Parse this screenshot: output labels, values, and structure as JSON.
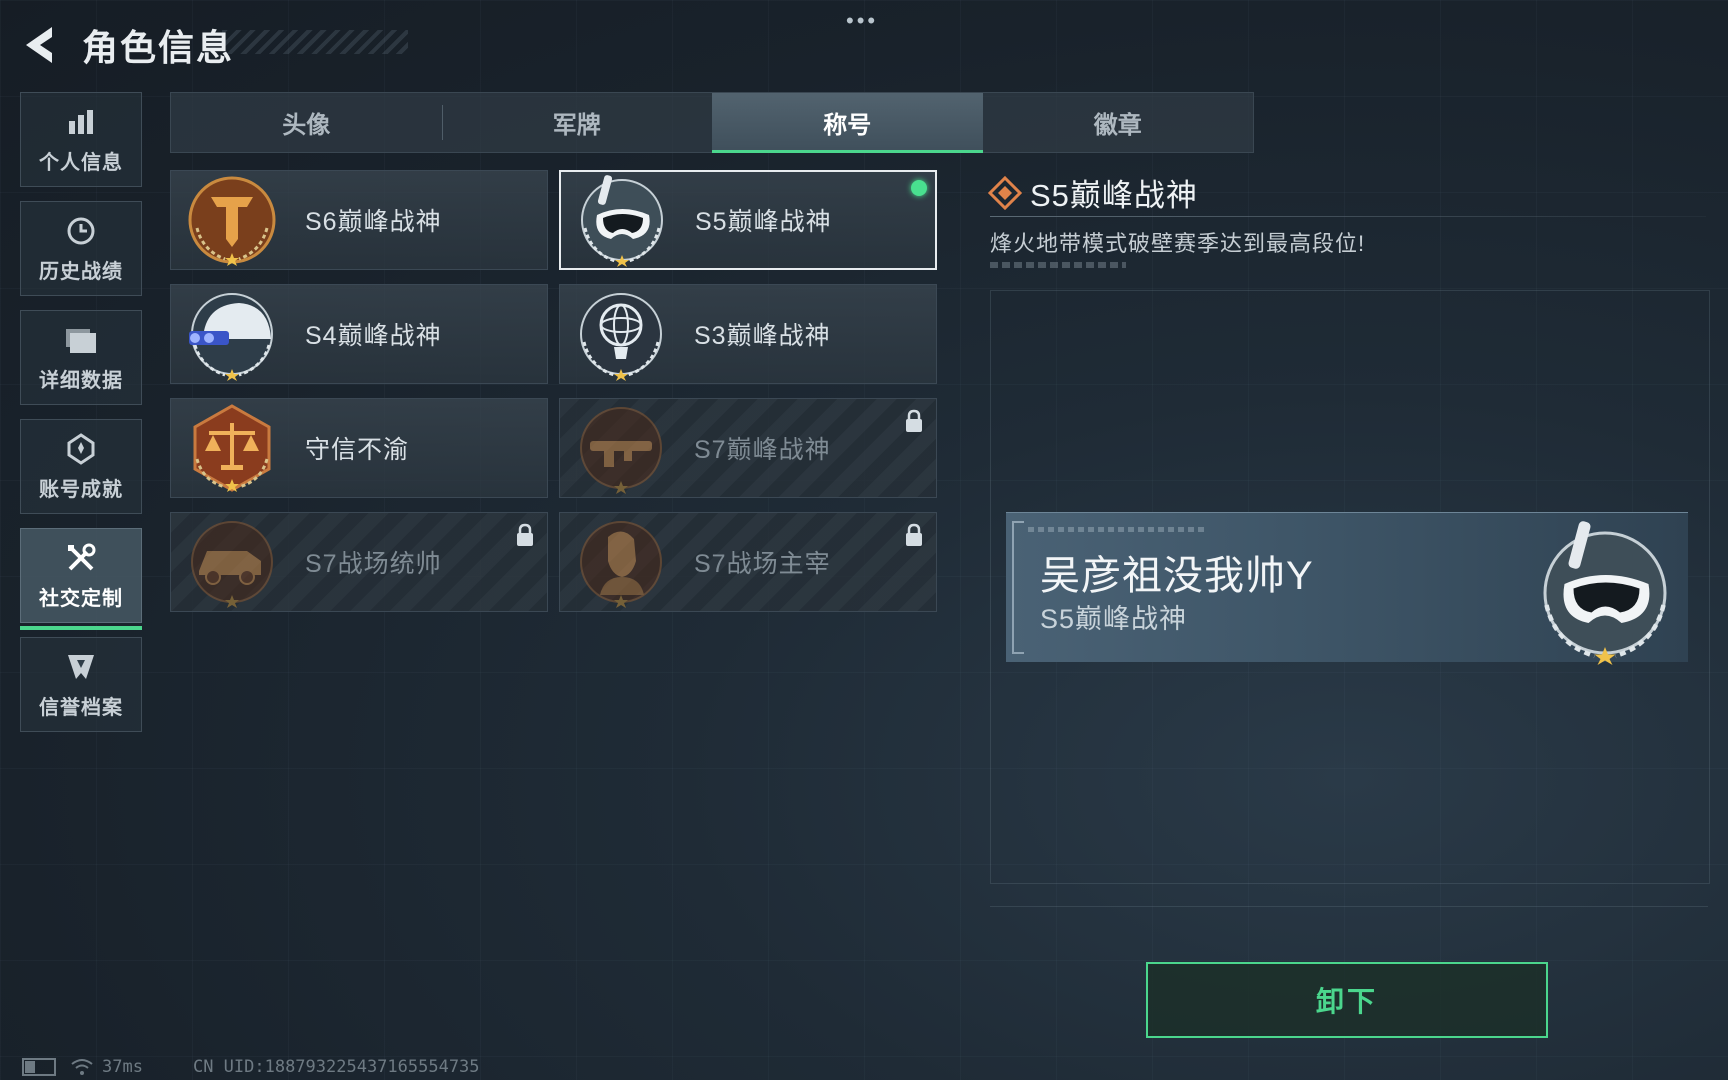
{
  "header": {
    "title": "角色信息",
    "menu_dots": "•••"
  },
  "sidebar": {
    "items": [
      {
        "label": "个人信息",
        "icon": "bar-chart-icon",
        "active": false
      },
      {
        "label": "历史战绩",
        "icon": "clock-icon",
        "active": false
      },
      {
        "label": "详细数据",
        "icon": "folder-icon",
        "active": false
      },
      {
        "label": "账号成就",
        "icon": "medal-icon",
        "active": false
      },
      {
        "label": "社交定制",
        "icon": "tools-icon",
        "active": true
      },
      {
        "label": "信誉档案",
        "icon": "shield-icon",
        "active": false
      }
    ]
  },
  "tabs": [
    {
      "label": "头像",
      "active": false
    },
    {
      "label": "军牌",
      "active": false
    },
    {
      "label": "称号",
      "active": true
    },
    {
      "label": "徽章",
      "active": false
    }
  ],
  "titles": [
    {
      "name": "S6巅峰战神",
      "emblem": "gold-t-emblem-icon",
      "locked": false,
      "selected": false
    },
    {
      "name": "S5巅峰战神",
      "emblem": "diving-mask-emblem-icon",
      "locked": false,
      "selected": true,
      "equipped": true
    },
    {
      "name": "S4巅峰战神",
      "emblem": "helmet-emblem-icon",
      "locked": false,
      "selected": false
    },
    {
      "name": "S3巅峰战神",
      "emblem": "globe-trophy-emblem-icon",
      "locked": false,
      "selected": false
    },
    {
      "name": "守信不渝",
      "emblem": "scales-emblem-icon",
      "locked": false,
      "selected": false
    },
    {
      "name": "S7巅峰战神",
      "emblem": "rifle-emblem-icon",
      "locked": true,
      "selected": false
    },
    {
      "name": "S7战场统帅",
      "emblem": "vehicle-emblem-icon",
      "locked": true,
      "selected": false
    },
    {
      "name": "S7战场主宰",
      "emblem": "soldier-emblem-icon",
      "locked": true,
      "selected": false
    }
  ],
  "detail": {
    "title": "S5巅峰战神",
    "description": "烽火地带模式破壁赛季达到最高段位!"
  },
  "preview": {
    "player_name": "吴彦祖没我帅Y",
    "title": "S5巅峰战神"
  },
  "actions": {
    "unequip_label": "卸下"
  },
  "status_bar": {
    "ping": "37ms",
    "uid": "CN UID:1887932254371655547​35"
  },
  "colors": {
    "accent_green": "#4bd68d",
    "equipped_dot": "#49e08f",
    "emblem_orange": "#e0834a"
  }
}
